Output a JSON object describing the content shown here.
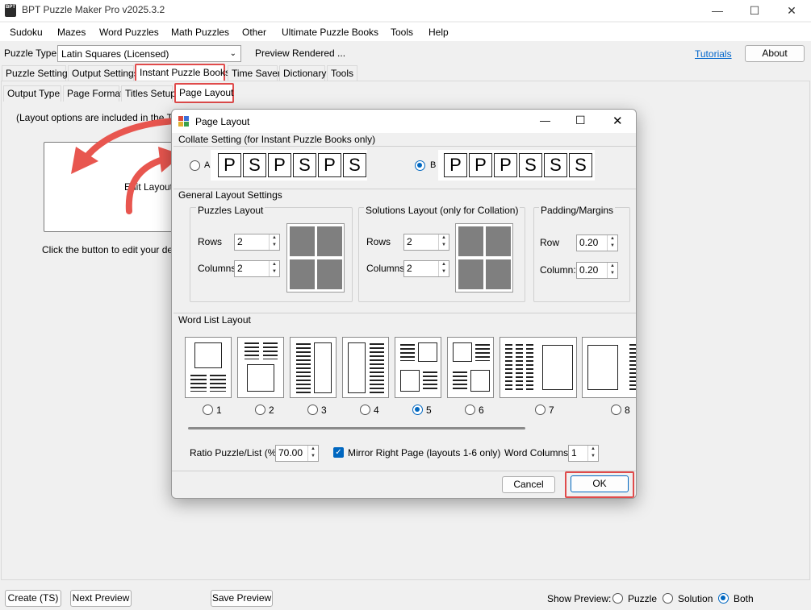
{
  "app": {
    "title": "BPT Puzzle Maker Pro v2025.3.2",
    "icon": "app-logo-icon",
    "icon_text": "BPT"
  },
  "window_controls": {
    "minimize": "—",
    "maximize": "☐",
    "close": "✕"
  },
  "menu": [
    "Sudoku",
    "Mazes",
    "Word Puzzles",
    "Math Puzzles",
    "Other",
    "Ultimate Puzzle Books",
    "Tools",
    "Help"
  ],
  "toolbar": {
    "puzzle_type_label": "Puzzle Type",
    "puzzle_type_value": "Latin Squares (Licensed)",
    "preview_status": "Preview Rendered ...",
    "tutorials": "Tutorials",
    "about": "About"
  },
  "main_tabs": [
    "Puzzle Settings",
    "Output Settings",
    "Instant Puzzle Books",
    "Time Saver",
    "Dictionary",
    "Tools"
  ],
  "sub_tabs": [
    "Output Type",
    "Page Format",
    "Titles Setup",
    "Page Layout"
  ],
  "page_layout_panel": {
    "info": "(Layout options are included in the Time",
    "edit_button": "Edit Layout",
    "hint": "Click the button to edit your default"
  },
  "dialog": {
    "title": "Page Layout",
    "controls": {
      "minimize": "—",
      "maximize": "☐",
      "close": "✕"
    },
    "collate": {
      "label": "Collate Setting (for Instant Puzzle Books only)",
      "option_a": "A",
      "option_b": "B",
      "selected": "B",
      "sequence_a": [
        "P",
        "S",
        "P",
        "S",
        "P",
        "S"
      ],
      "sequence_b": [
        "P",
        "P",
        "P",
        "S",
        "S",
        "S"
      ]
    },
    "general_label": "General Layout Settings",
    "puzzles_layout": {
      "label": "Puzzles Layout",
      "rows_label": "Rows",
      "rows": "2",
      "columns_label": "Columns",
      "columns": "2"
    },
    "solutions_layout": {
      "label": "Solutions Layout (only for Collation)",
      "rows_label": "Rows",
      "rows": "2",
      "columns_label": "Columns",
      "columns": "2"
    },
    "padding": {
      "label": "Padding/Margins",
      "row_label": "Row",
      "row": "0.20",
      "column_label": "Column:",
      "column": "0.20"
    },
    "word_list": {
      "label": "Word List Layout",
      "options": [
        "1",
        "2",
        "3",
        "4",
        "5",
        "6",
        "7",
        "8"
      ],
      "selected": "5"
    },
    "ratio_label": "Ratio Puzzle/List (%)",
    "ratio": "70.00",
    "mirror_label": "Mirror Right Page (layouts 1-6 only)",
    "mirror_checked": true,
    "word_columns_label": "Word Columns",
    "word_columns": "1",
    "cancel": "Cancel",
    "ok": "OK"
  },
  "bottom": {
    "create": "Create (TS)",
    "next_preview": "Next Preview",
    "save_preview": "Save Preview",
    "show_preview_label": "Show Preview:",
    "preview_options": [
      "Puzzle",
      "Solution",
      "Both"
    ],
    "preview_selected": "Both"
  },
  "colors": {
    "highlight": "#e04b4b",
    "accent": "#0067c0",
    "arrow": "#e8564f"
  }
}
